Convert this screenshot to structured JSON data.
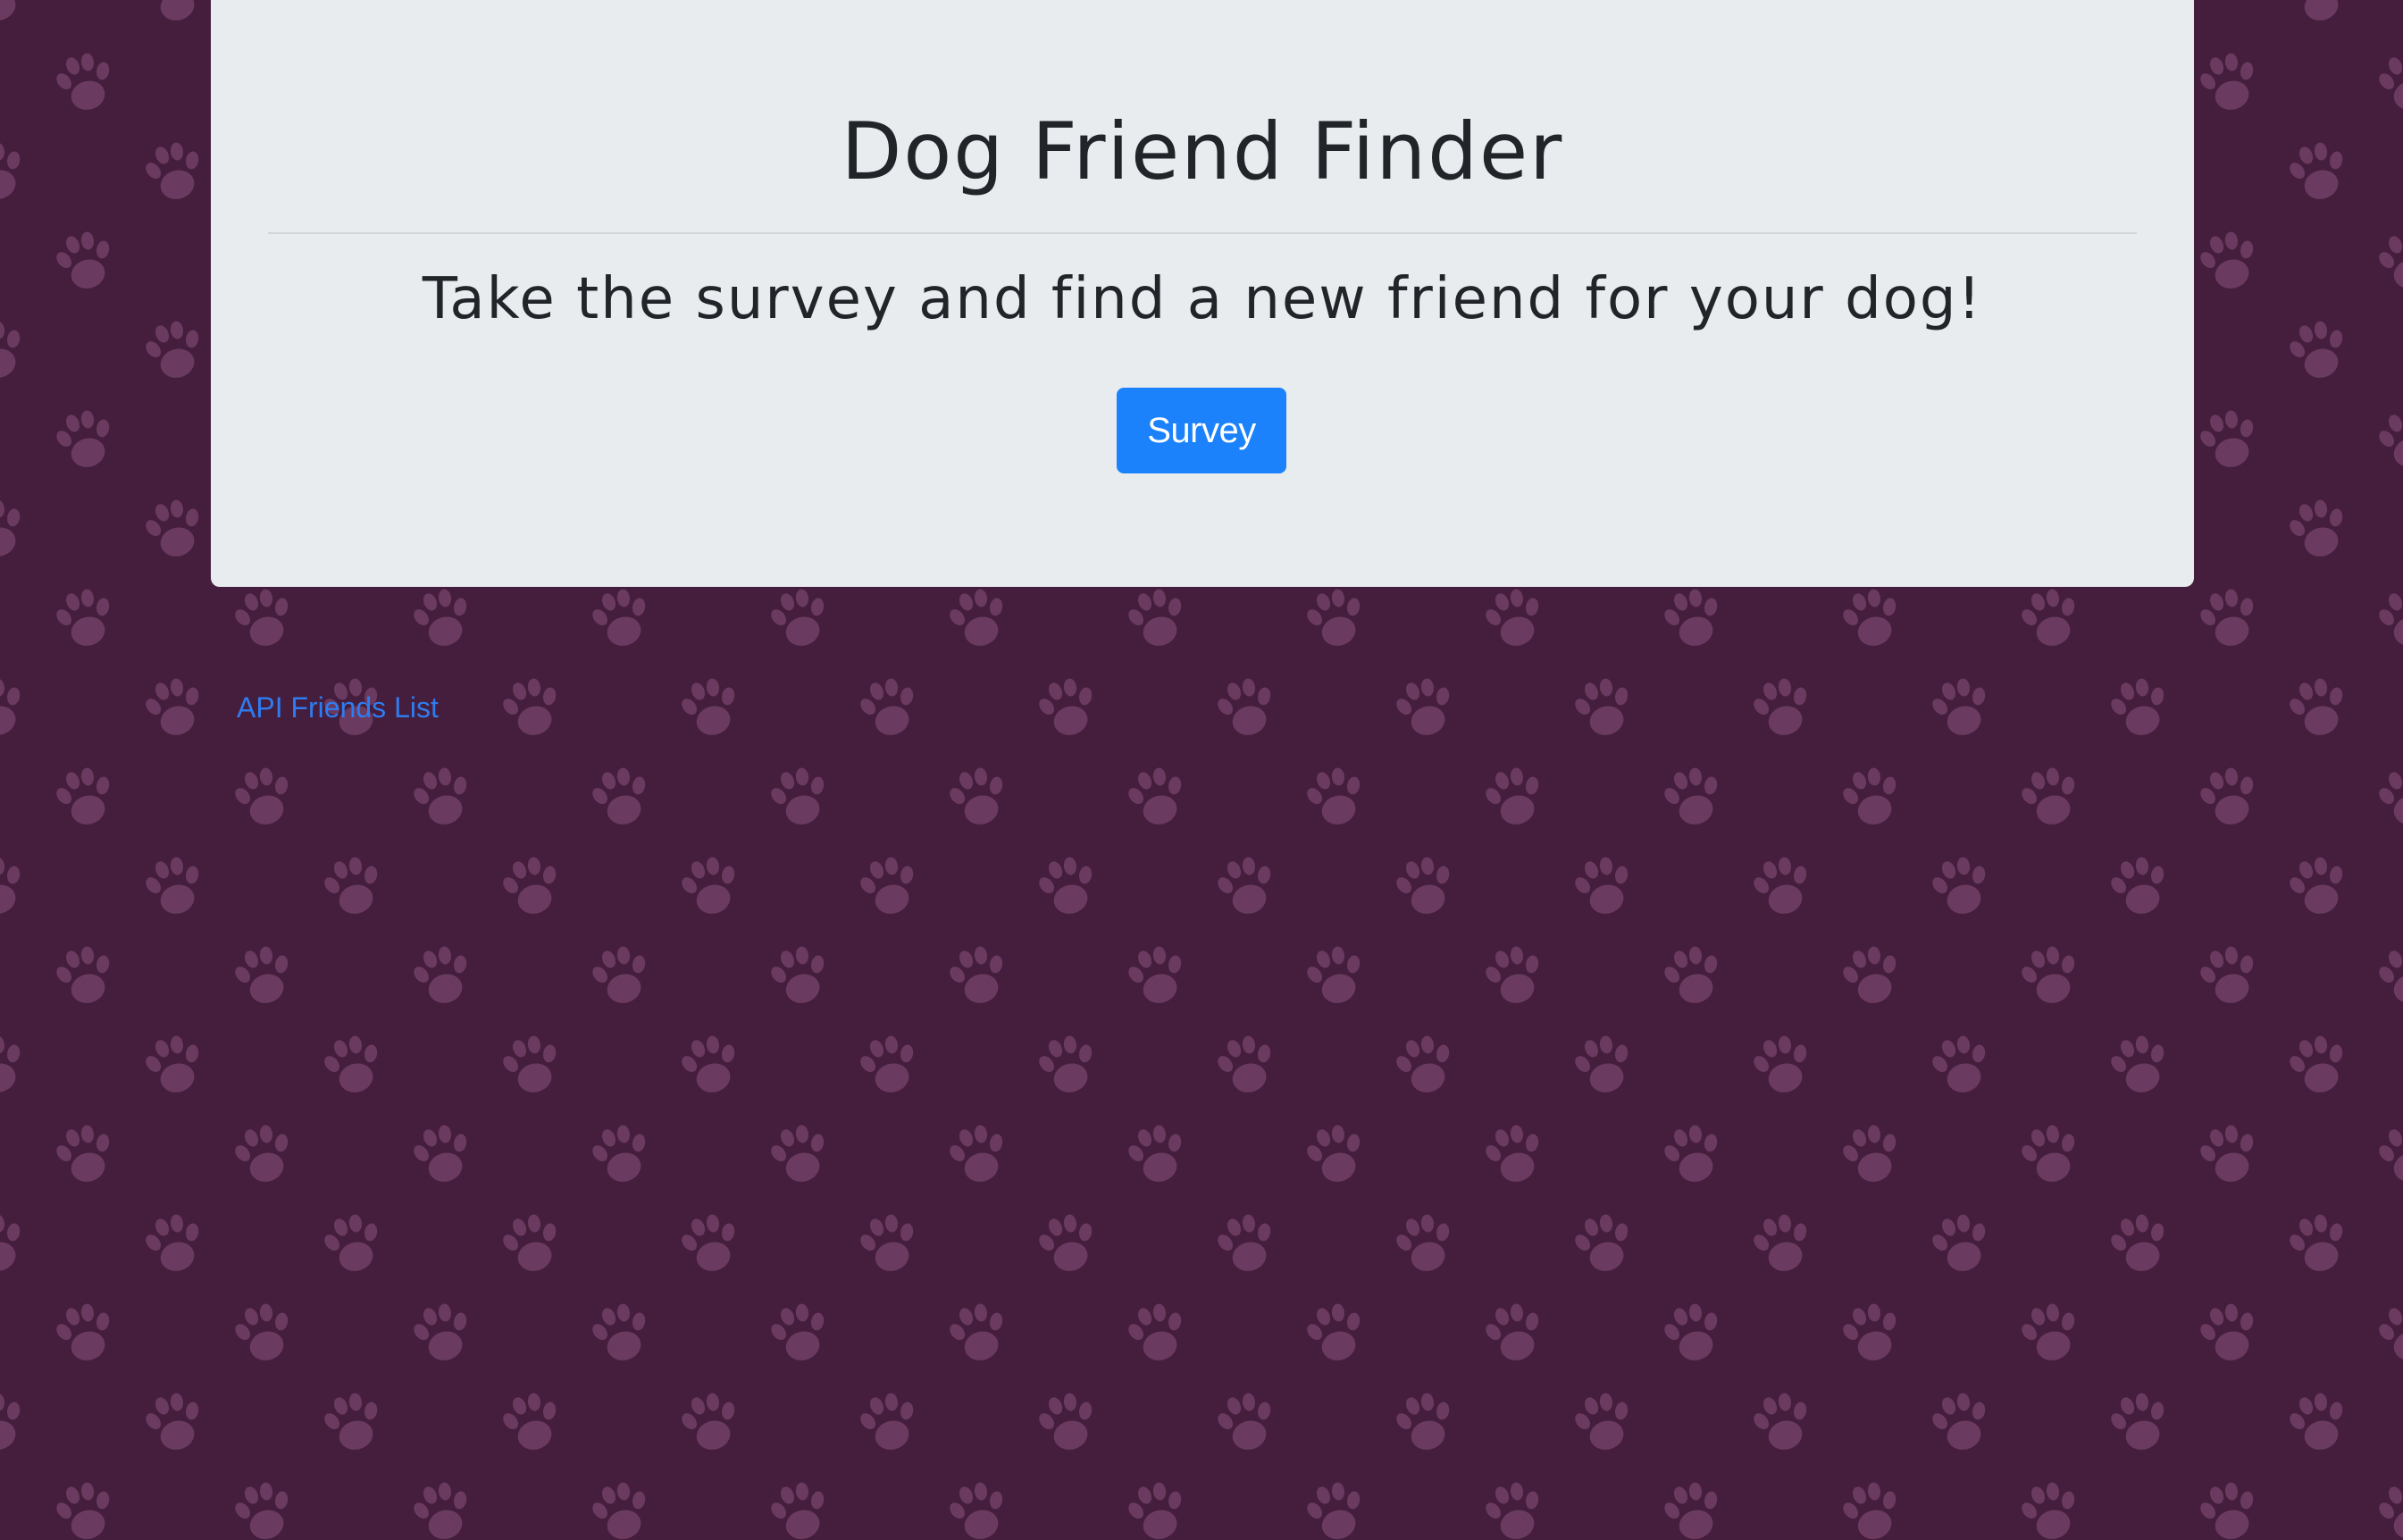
{
  "page": {
    "background_color": "#441e3c",
    "paw_pattern_color": "#6b3a60"
  },
  "jumbotron": {
    "title": "Dog Friend Finder",
    "lead": "Take the survey and find a new friend for your dog!",
    "survey_button_label": "Survey",
    "background_color": "#e9ecef",
    "text_color": "#212529",
    "button_color": "#1b82fb"
  },
  "footer": {
    "api_link_label": "API Friends List",
    "link_color": "#2f7cf0"
  },
  "icons": {
    "background_pattern": "paw-print-icon"
  }
}
